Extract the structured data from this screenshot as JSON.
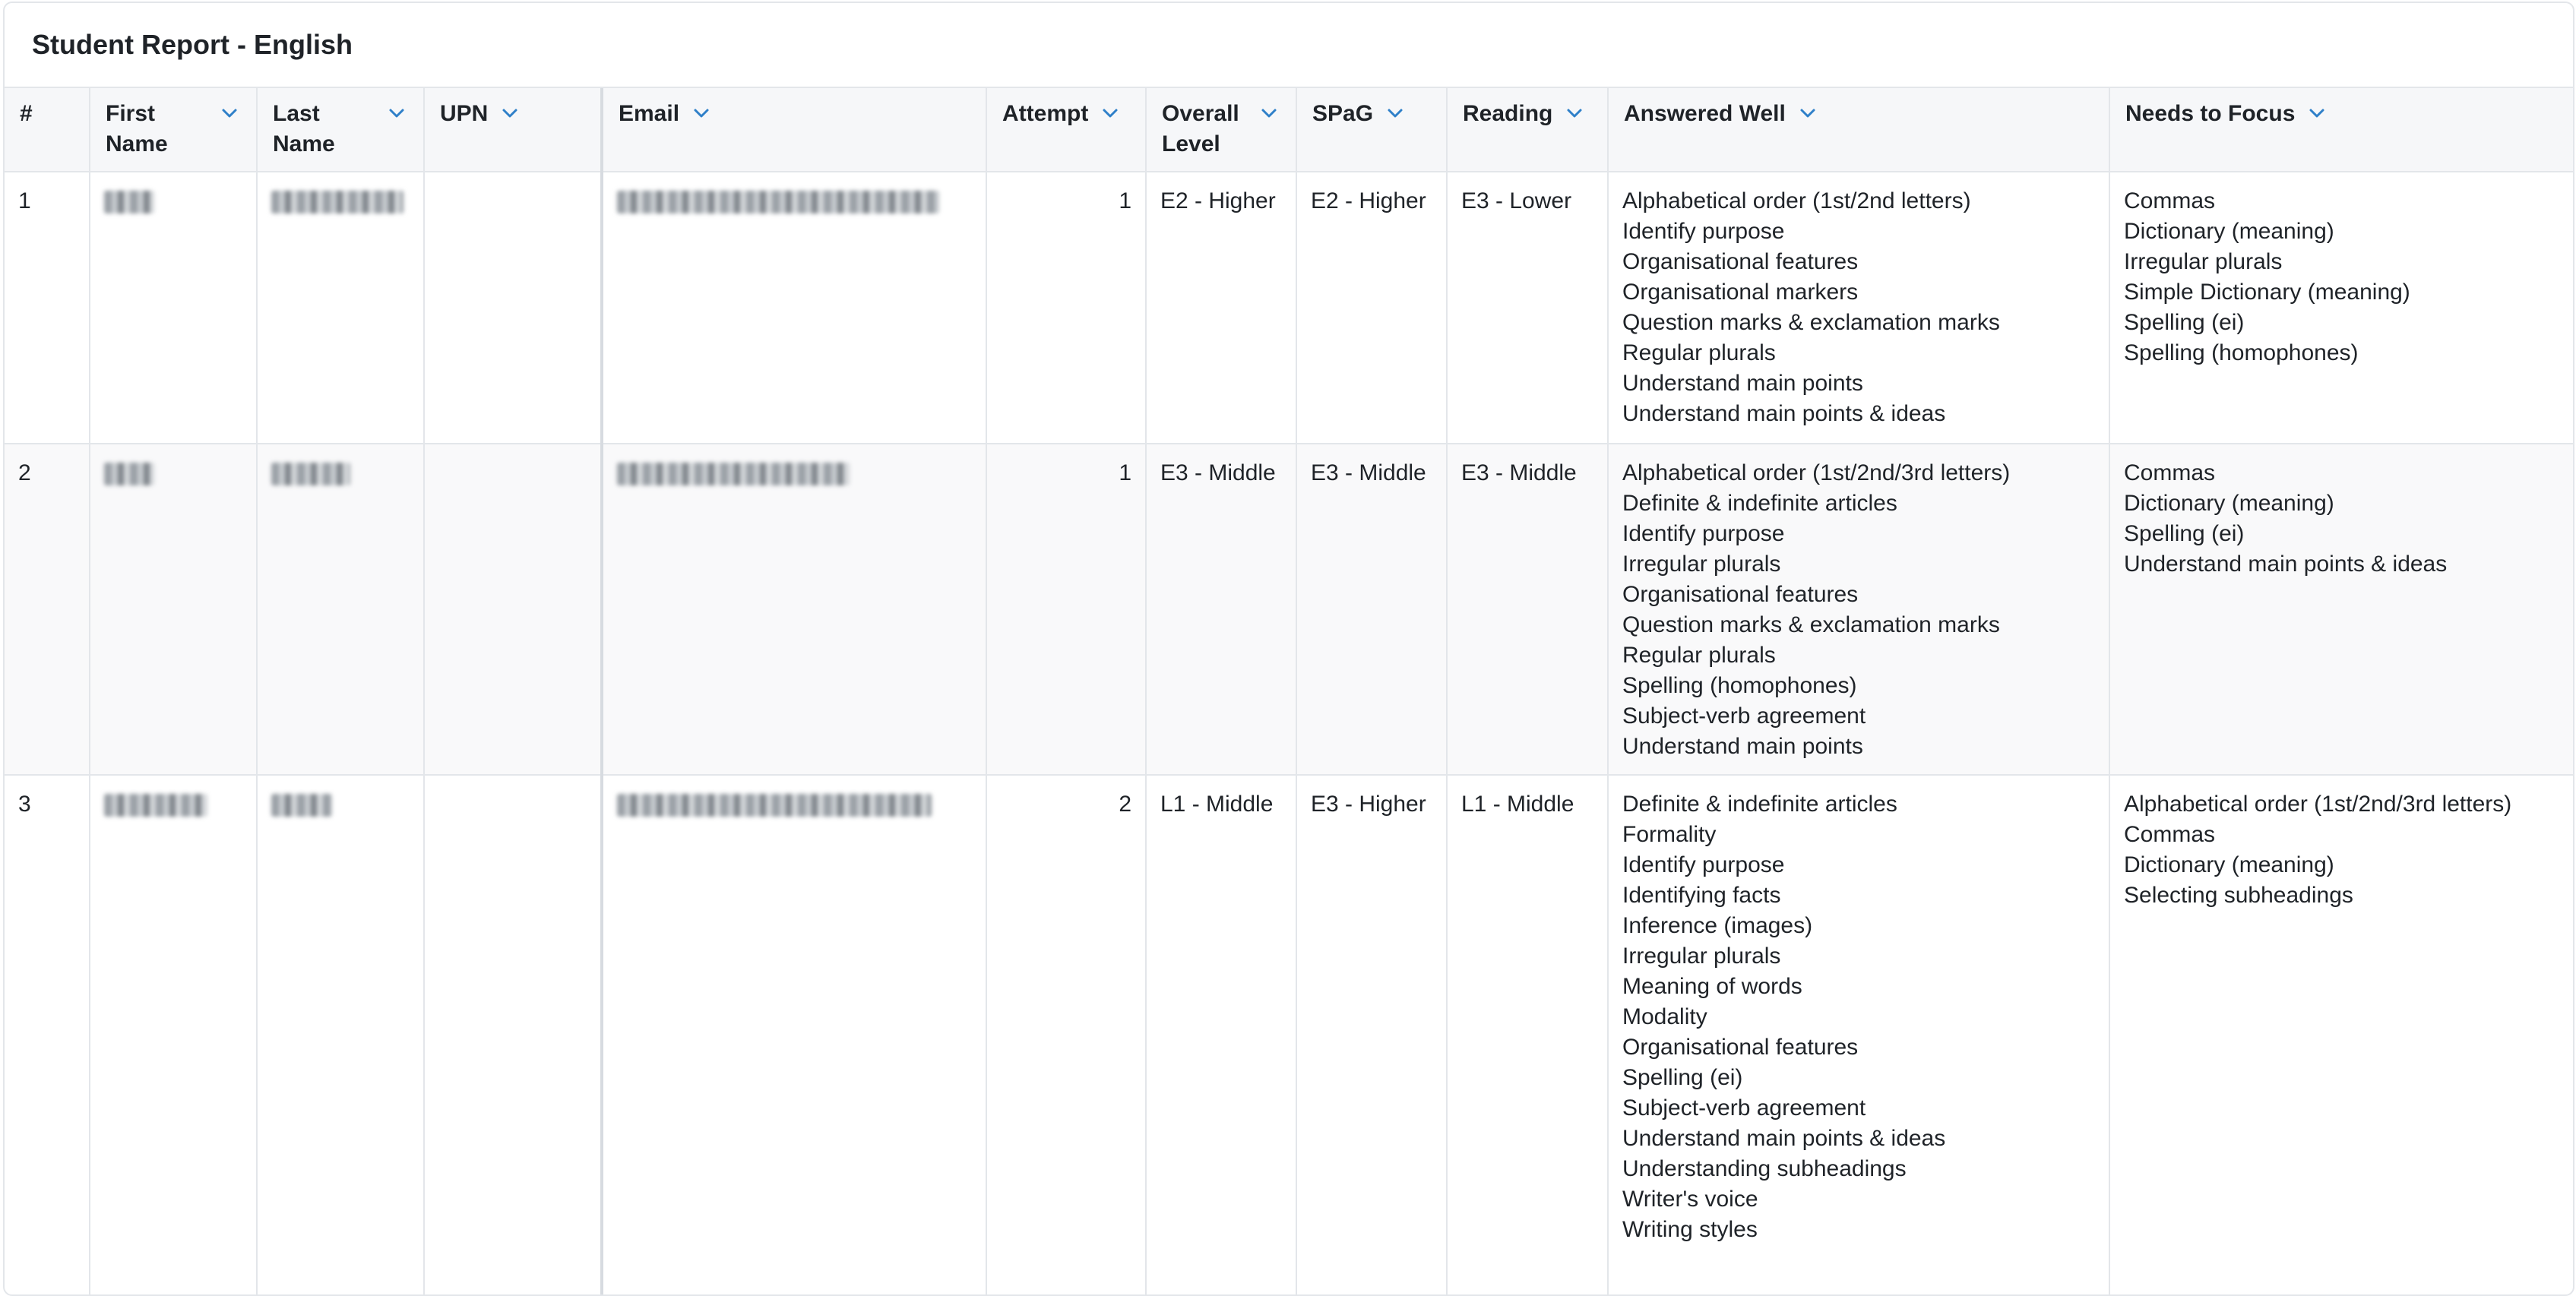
{
  "report": {
    "title": "Student Report - English"
  },
  "columns": {
    "index": "#",
    "first_name": "First Name",
    "last_name": "Last Name",
    "upn": "UPN",
    "email": "Email",
    "attempt": "Attempt",
    "overall_level": "Overall Level",
    "spag": "SPaG",
    "reading": "Reading",
    "answered_well": "Answered Well",
    "needs_to_focus": "Needs to Focus"
  },
  "rows": [
    {
      "index": "1",
      "first_name": "",
      "last_name": "",
      "upn": "",
      "email": "",
      "attempt": "1",
      "overall_level": "E2 - Higher",
      "spag": "E2 - Higher",
      "reading": "E3 - Lower",
      "answered_well": [
        "Alphabetical order (1st/2nd letters)",
        "Identify purpose",
        "Organisational features",
        "Organisational markers",
        "Question marks & exclamation marks",
        "Regular plurals",
        "Understand main points",
        "Understand main points & ideas"
      ],
      "needs_to_focus": [
        "Commas",
        "Dictionary (meaning)",
        "Irregular plurals",
        "Simple Dictionary (meaning)",
        "Spelling (ei)",
        "Spelling (homophones)"
      ]
    },
    {
      "index": "2",
      "first_name": "",
      "last_name": "",
      "upn": "",
      "email": "",
      "attempt": "1",
      "overall_level": "E3 - Middle",
      "spag": "E3 - Middle",
      "reading": "E3 - Middle",
      "answered_well": [
        "Alphabetical order (1st/2nd/3rd letters)",
        "Definite & indefinite articles",
        "Identify purpose",
        "Irregular plurals",
        "Organisational features",
        "Question marks & exclamation marks",
        "Regular plurals",
        "Spelling (homophones)",
        "Subject-verb agreement",
        "Understand main points"
      ],
      "needs_to_focus": [
        "Commas",
        "Dictionary (meaning)",
        "Spelling (ei)",
        "Understand main points & ideas"
      ]
    },
    {
      "index": "3",
      "first_name": "",
      "last_name": "",
      "upn": "",
      "email": "",
      "attempt": "2",
      "overall_level": "L1 - Middle",
      "spag": "E3 - Higher",
      "reading": "L1 - Middle",
      "answered_well": [
        "Definite & indefinite articles",
        "Formality",
        "Identify purpose",
        "Identifying facts",
        "Inference (images)",
        "Irregular plurals",
        "Meaning of words",
        "Modality",
        "Organisational features",
        "Spelling (ei)",
        "Subject-verb agreement",
        "Understand main points & ideas",
        "Understanding subheadings",
        "Writer's voice",
        "Writing styles"
      ],
      "needs_to_focus": [
        "Alphabetical order (1st/2nd/3rd letters)",
        "Commas",
        "Dictionary (meaning)",
        "Selecting subheadings"
      ]
    }
  ],
  "icons": {
    "sort": "chevron-down-icon"
  },
  "colors": {
    "accent": "#2f80c9",
    "header_bg": "#f6f7f9",
    "border": "#e3e6ea",
    "alt_row_bg": "#f9f9fa"
  }
}
